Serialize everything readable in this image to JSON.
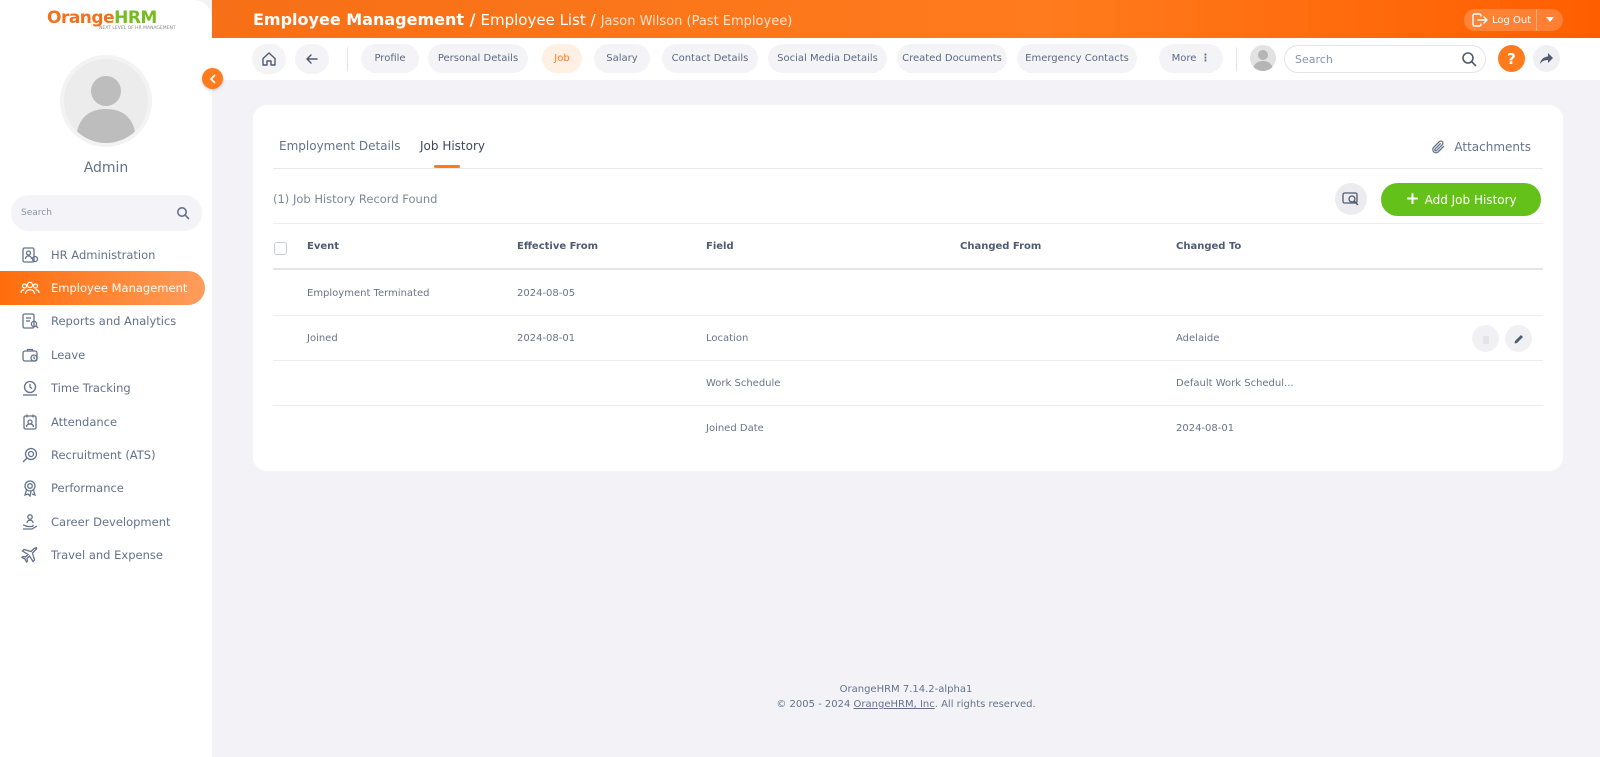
{
  "brand": {
    "logo_orange": "Orange",
    "logo_hrm": "HRM",
    "tagline": "NEXT LEVEL OF HR MANAGEMENT"
  },
  "sidebar": {
    "user_name": "Admin",
    "search_placeholder": "Search",
    "items": [
      {
        "label": "HR Administration",
        "icon": "hr-admin-icon",
        "active": false
      },
      {
        "label": "Employee Management",
        "icon": "employee-group-icon",
        "active": true
      },
      {
        "label": "Reports and Analytics",
        "icon": "report-icon",
        "active": false
      },
      {
        "label": "Leave",
        "icon": "suitcase-icon",
        "active": false
      },
      {
        "label": "Time Tracking",
        "icon": "clock-icon",
        "active": false
      },
      {
        "label": "Attendance",
        "icon": "attendance-icon",
        "active": false
      },
      {
        "label": "Recruitment (ATS)",
        "icon": "recruitment-icon",
        "active": false
      },
      {
        "label": "Performance",
        "icon": "medal-icon",
        "active": false
      },
      {
        "label": "Career Development",
        "icon": "career-icon",
        "active": false
      },
      {
        "label": "Travel and Expense",
        "icon": "plane-icon",
        "active": false
      }
    ]
  },
  "header": {
    "title_module": "Employee Management /",
    "title_list": "Employee List /",
    "title_employee": "Jason Wilson (Past Employee)",
    "logout_label": "Log Out"
  },
  "nav": {
    "tabs": [
      {
        "label": "Profile",
        "active": false
      },
      {
        "label": "Personal Details",
        "active": false
      },
      {
        "label": "Job",
        "active": true
      },
      {
        "label": "Salary",
        "active": false
      },
      {
        "label": "Contact Details",
        "active": false
      },
      {
        "label": "Social Media Details",
        "active": false
      },
      {
        "label": "Created Documents",
        "active": false
      },
      {
        "label": "Emergency Contacts",
        "active": false
      },
      {
        "label": "More",
        "active": false
      }
    ],
    "search_placeholder": "Search",
    "help_label": "?"
  },
  "content": {
    "tabs": [
      {
        "label": "Employment Details",
        "active": false
      },
      {
        "label": "Job History",
        "active": true
      }
    ],
    "attachments_label": "Attachments",
    "records_found": "(1) Job History Record Found",
    "add_button": "Add Job History",
    "columns": [
      "Event",
      "Effective From",
      "Field",
      "Changed From",
      "Changed To"
    ],
    "rows": [
      {
        "event": "Employment Terminated",
        "effective_from": "2024-08-05",
        "field": "",
        "changed_from": "",
        "changed_to": ""
      },
      {
        "event": "Joined",
        "effective_from": "2024-08-01",
        "field": "Location",
        "changed_from": "",
        "changed_to": "Adelaide"
      },
      {
        "event": "",
        "effective_from": "",
        "field": "Work Schedule",
        "changed_from": "",
        "changed_to": "Default Work Schedul..."
      },
      {
        "event": "",
        "effective_from": "",
        "field": "Joined Date",
        "changed_from": "",
        "changed_to": "2024-08-01"
      }
    ]
  },
  "footer": {
    "version": "OrangeHRM 7.14.2-alpha1",
    "copyright_prefix": "© 2005 - 2024",
    "company_link": "OrangeHRM, Inc",
    "copyright_suffix": ". All rights reserved."
  },
  "colors": {
    "accent": "#ff7b1d",
    "success": "#64c11a",
    "text": "#64728c"
  }
}
